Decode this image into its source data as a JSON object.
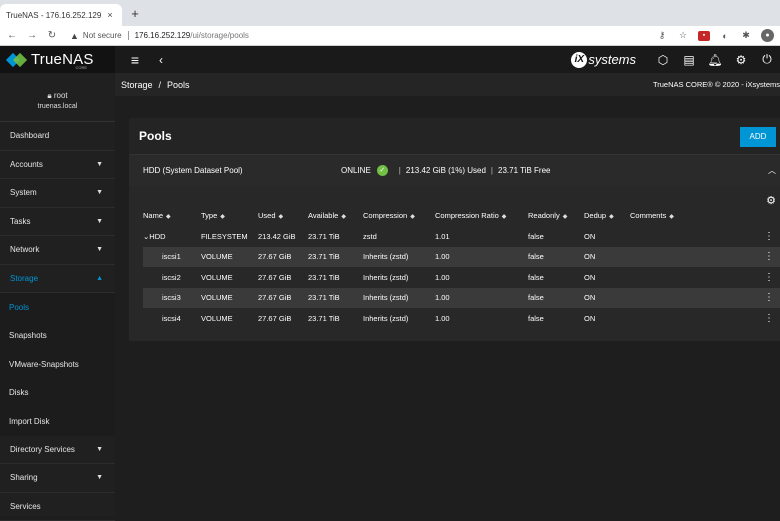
{
  "browser": {
    "tab_title": "TrueNAS - 176.16.252.129",
    "tab_close": "×",
    "new_tab": "+",
    "not_secure": "Not secure",
    "url_host": "176.16.252.129",
    "url_path": "/ui/storage/pools"
  },
  "topbar": {
    "brand": "TrueNAS",
    "brand_sub": "CORE",
    "ix_mark": "iX",
    "ix_text": "systems"
  },
  "sidebar": {
    "user": "root",
    "host": "truenas.local",
    "items": [
      {
        "label": "Dashboard",
        "chevron": ""
      },
      {
        "label": "Accounts",
        "chevron": "▼"
      },
      {
        "label": "System",
        "chevron": "▼"
      },
      {
        "label": "Tasks",
        "chevron": "▼"
      },
      {
        "label": "Network",
        "chevron": "▼"
      },
      {
        "label": "Storage",
        "chevron": "▲"
      }
    ],
    "sub_items": [
      "Pools",
      "Snapshots",
      "VMware-Snapshots",
      "Disks",
      "Import Disk"
    ],
    "bottom_items": [
      {
        "label": "Directory Services",
        "chevron": "▼"
      },
      {
        "label": "Sharing",
        "chevron": "▼"
      },
      {
        "label": "Services",
        "chevron": ""
      }
    ]
  },
  "breadcrumb": {
    "root": "Storage",
    "sep": "/",
    "current": "Pools",
    "copyright": "TrueNAS CORE® © 2020 - iXsystems"
  },
  "pools_card": {
    "title": "Pools",
    "add_label": "ADD",
    "pool": {
      "name": "HDD   (System Dataset Pool)",
      "status": "ONLINE",
      "used": "213.42 GiB (1%) Used",
      "free": "23.71 TiB Free",
      "separator": "|"
    },
    "columns": [
      "Name",
      "Type",
      "Used",
      "Available",
      "Compression",
      "Compression Ratio",
      "Readonly",
      "Dedup",
      "Comments"
    ],
    "rows": [
      {
        "name": "HDD",
        "type": "FILESYSTEM",
        "used": "213.42 GiB",
        "available": "23.71 TiB",
        "compression": "zstd",
        "ratio": "1.01",
        "readonly": "false",
        "dedup": "ON",
        "comments": ""
      },
      {
        "name": "iscsi1",
        "type": "VOLUME",
        "used": "27.67 GiB",
        "available": "23.71 TiB",
        "compression": "Inherits (zstd)",
        "ratio": "1.00",
        "readonly": "false",
        "dedup": "ON",
        "comments": ""
      },
      {
        "name": "iscsi2",
        "type": "VOLUME",
        "used": "27.67 GiB",
        "available": "23.71 TiB",
        "compression": "Inherits (zstd)",
        "ratio": "1.00",
        "readonly": "false",
        "dedup": "ON",
        "comments": ""
      },
      {
        "name": "iscsi3",
        "type": "VOLUME",
        "used": "27.67 GiB",
        "available": "23.71 TiB",
        "compression": "Inherits (zstd)",
        "ratio": "1.00",
        "readonly": "false",
        "dedup": "ON",
        "comments": ""
      },
      {
        "name": "iscsi4",
        "type": "VOLUME",
        "used": "27.67 GiB",
        "available": "23.71 TiB",
        "compression": "Inherits (zstd)",
        "ratio": "1.00",
        "readonly": "false",
        "dedup": "ON",
        "comments": ""
      }
    ]
  },
  "colors": {
    "accent": "#0095d5",
    "success": "#71bf44",
    "background": "#1e1e1e"
  },
  "icons": {
    "status": "check-circle-icon",
    "settings": "gear-icon",
    "row_menu": "kebab-menu-icon"
  }
}
